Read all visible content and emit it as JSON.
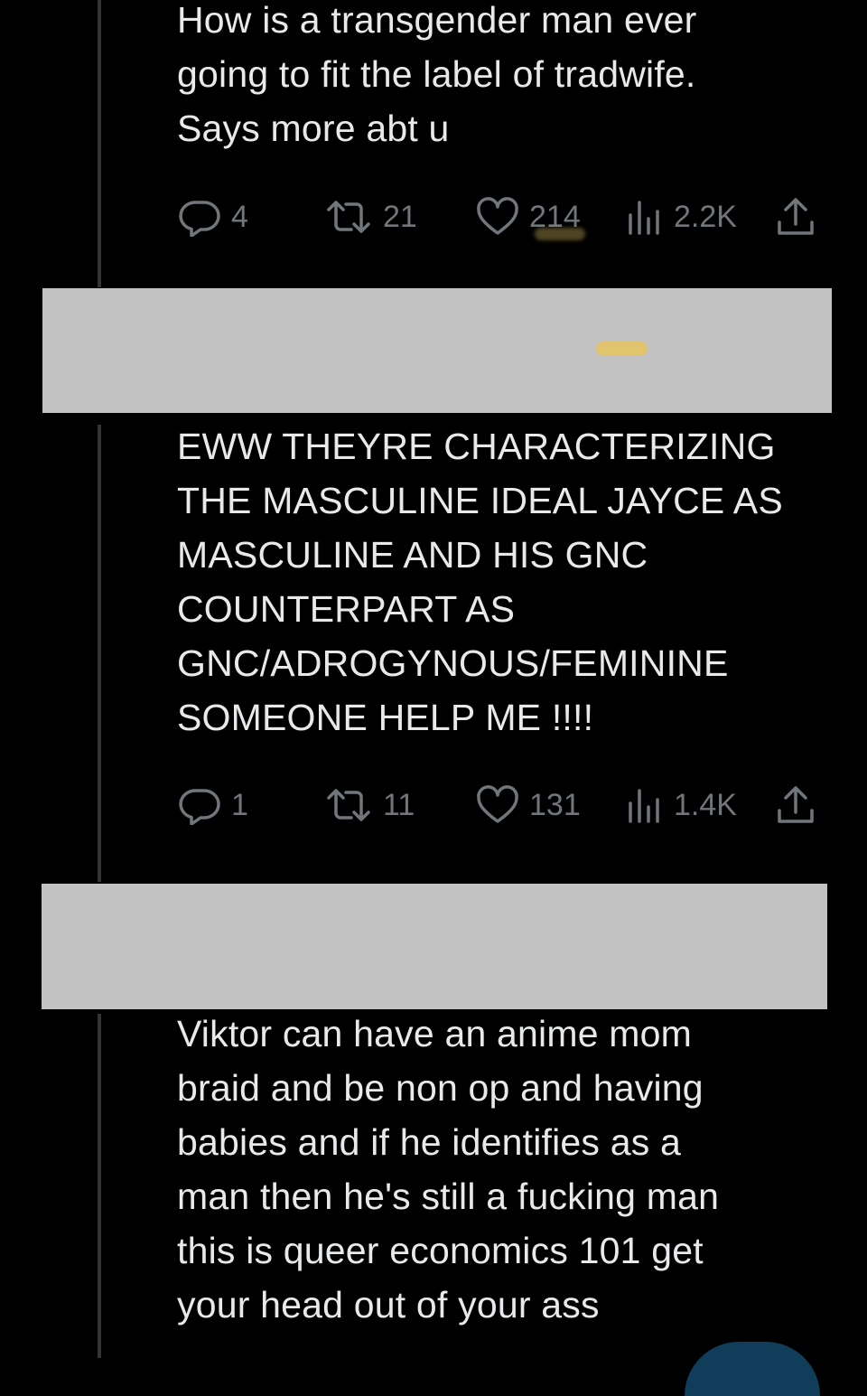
{
  "tweets": [
    {
      "text": "How is a transgender man ever\ngoing to fit the label of tradwife.\nSays more abt u",
      "replies": "4",
      "retweets": "21",
      "likes": "214",
      "views": "2.2K"
    },
    {
      "text": "EWW THEYRE CHARACTERIZING\nTHE MASCULINE IDEAL JAYCE AS\nMASCULINE AND HIS GNC\nCOUNTERPART AS\nGNC/ADROGYNOUS/FEMININE\nSOMEONE HELP ME !!!!",
      "replies": "1",
      "retweets": "11",
      "likes": "131",
      "views": "1.4K"
    },
    {
      "text": "Viktor can have an anime mom\nbraid and be non op and having\nbabies and if he identifies as a\nman then he's still a fucking man\nthis is queer economics 101 get\nyour head out of your ass"
    }
  ],
  "colors": {
    "background": "#000000",
    "text": "#e7e9ea",
    "muted": "#71767b",
    "thread_line": "#333639",
    "redaction": "#c2c2c2",
    "highlighter": "#e3c565"
  },
  "icons": [
    "reply-icon",
    "retweet-icon",
    "like-icon",
    "views-icon",
    "share-icon"
  ]
}
